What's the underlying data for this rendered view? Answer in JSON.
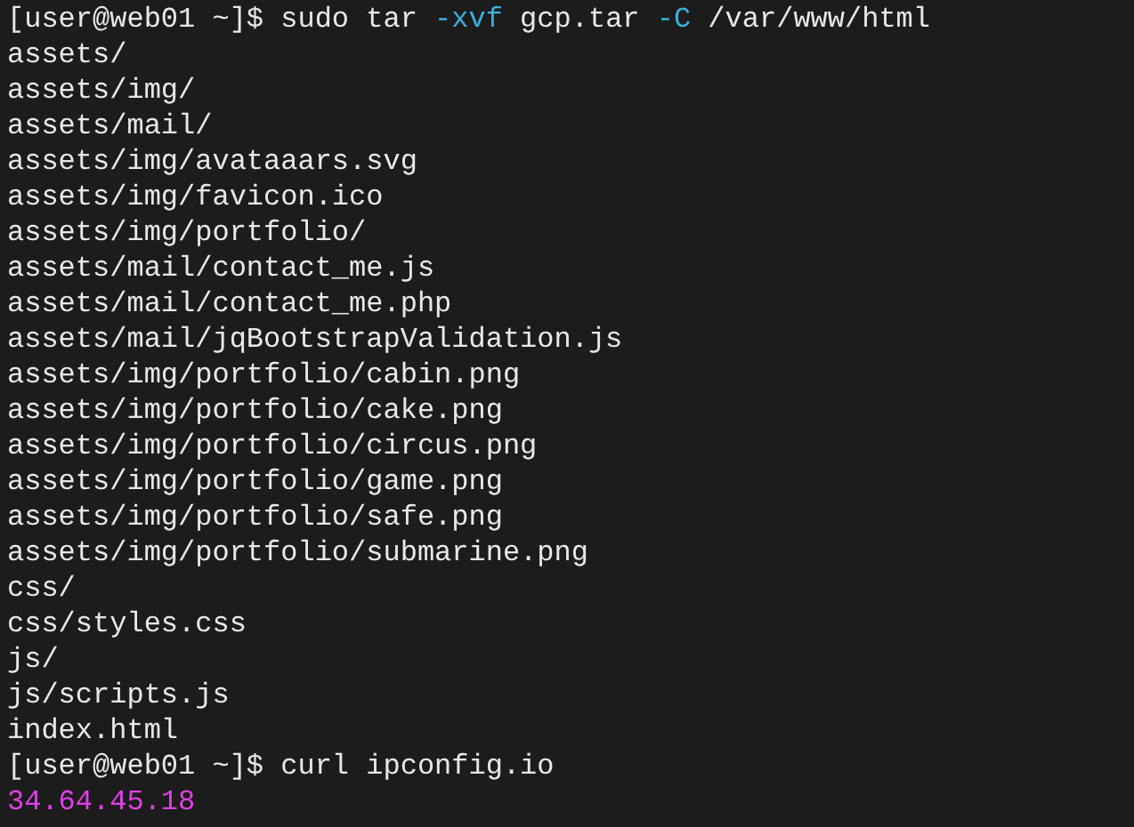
{
  "terminal": {
    "lines": [
      {
        "segments": [
          {
            "text": "[user@web01 ~]$ sudo tar ",
            "color": "#e8e8e8"
          },
          {
            "text": "-xvf",
            "color": "#3ab0e0"
          },
          {
            "text": " gcp.tar ",
            "color": "#e8e8e8"
          },
          {
            "text": "-C",
            "color": "#3ab0e0"
          },
          {
            "text": " /var/www/html",
            "color": "#e8e8e8"
          }
        ]
      },
      {
        "segments": [
          {
            "text": "assets/",
            "color": "#e8e8e8"
          }
        ]
      },
      {
        "segments": [
          {
            "text": "assets/img/",
            "color": "#e8e8e8"
          }
        ]
      },
      {
        "segments": [
          {
            "text": "assets/mail/",
            "color": "#e8e8e8"
          }
        ]
      },
      {
        "segments": [
          {
            "text": "assets/img/avataaars.svg",
            "color": "#e8e8e8"
          }
        ]
      },
      {
        "segments": [
          {
            "text": "assets/img/favicon.ico",
            "color": "#e8e8e8"
          }
        ]
      },
      {
        "segments": [
          {
            "text": "assets/img/portfolio/",
            "color": "#e8e8e8"
          }
        ]
      },
      {
        "segments": [
          {
            "text": "assets/mail/contact_me.js",
            "color": "#e8e8e8"
          }
        ]
      },
      {
        "segments": [
          {
            "text": "assets/mail/contact_me.php",
            "color": "#e8e8e8"
          }
        ]
      },
      {
        "segments": [
          {
            "text": "assets/mail/jqBootstrapValidation.js",
            "color": "#e8e8e8"
          }
        ]
      },
      {
        "segments": [
          {
            "text": "assets/img/portfolio/cabin.png",
            "color": "#e8e8e8"
          }
        ]
      },
      {
        "segments": [
          {
            "text": "assets/img/portfolio/cake.png",
            "color": "#e8e8e8"
          }
        ]
      },
      {
        "segments": [
          {
            "text": "assets/img/portfolio/circus.png",
            "color": "#e8e8e8"
          }
        ]
      },
      {
        "segments": [
          {
            "text": "assets/img/portfolio/game.png",
            "color": "#e8e8e8"
          }
        ]
      },
      {
        "segments": [
          {
            "text": "assets/img/portfolio/safe.png",
            "color": "#e8e8e8"
          }
        ]
      },
      {
        "segments": [
          {
            "text": "assets/img/portfolio/submarine.png",
            "color": "#e8e8e8"
          }
        ]
      },
      {
        "segments": [
          {
            "text": "css/",
            "color": "#e8e8e8"
          }
        ]
      },
      {
        "segments": [
          {
            "text": "css/styles.css",
            "color": "#e8e8e8"
          }
        ]
      },
      {
        "segments": [
          {
            "text": "js/",
            "color": "#e8e8e8"
          }
        ]
      },
      {
        "segments": [
          {
            "text": "js/scripts.js",
            "color": "#e8e8e8"
          }
        ]
      },
      {
        "segments": [
          {
            "text": "index.html",
            "color": "#e8e8e8"
          }
        ]
      },
      {
        "segments": [
          {
            "text": "[user@web01 ~]$ curl ipconfig.io",
            "color": "#e8e8e8"
          }
        ]
      },
      {
        "segments": [
          {
            "text": "34.64.45.18",
            "color": "#e040e8"
          }
        ]
      }
    ]
  }
}
